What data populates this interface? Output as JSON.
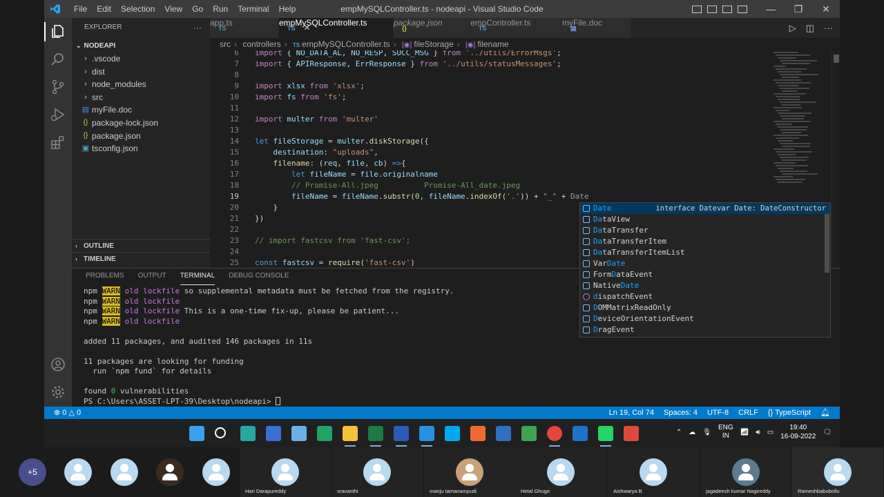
{
  "window": {
    "title": "empMySQLController.ts - nodeapi - Visual Studio Code",
    "menu": [
      "File",
      "Edit",
      "Selection",
      "View",
      "Go",
      "Run",
      "Terminal",
      "Help"
    ]
  },
  "activity_bar": {
    "items": [
      "explorer-icon",
      "search-icon",
      "source-control-icon",
      "run-debug-icon",
      "extensions-icon"
    ],
    "bottom": [
      "account-icon",
      "settings-gear-icon"
    ]
  },
  "explorer": {
    "title": "EXPLORER",
    "more": "···",
    "root": "NODEAPI",
    "items": [
      {
        "label": ".vscode",
        "type": "folder"
      },
      {
        "label": "dist",
        "type": "folder"
      },
      {
        "label": "node_modules",
        "type": "folder"
      },
      {
        "label": "src",
        "type": "folder"
      },
      {
        "label": "myFile.doc",
        "type": "doc"
      },
      {
        "label": "package-lock.json",
        "type": "json"
      },
      {
        "label": "package.json",
        "type": "json"
      },
      {
        "label": "tsconfig.json",
        "type": "ts"
      }
    ],
    "outline": "OUTLINE",
    "timeline": "TIMELINE"
  },
  "tabs": [
    {
      "label": "app.ts",
      "icon": "TS",
      "active": false
    },
    {
      "label": "empMySQLController.ts",
      "icon": "TS",
      "active": true,
      "close": "✕"
    },
    {
      "label": "package.json",
      "icon": "{}",
      "active": false
    },
    {
      "label": "empController.ts",
      "icon": "TS",
      "active": false
    },
    {
      "label": "myFile.doc",
      "icon": "doc",
      "active": false
    }
  ],
  "breadcrumb": [
    "src",
    "controllers",
    "empMySQLController.ts",
    "fileStorage",
    "filename"
  ],
  "editor": {
    "line_numbers": [
      "6",
      "7",
      "8",
      "9",
      "10",
      "11",
      "12",
      "13",
      "14",
      "15",
      "16",
      "17",
      "18",
      "19",
      "20",
      "21",
      "22",
      "23",
      "24",
      "25"
    ],
    "current_line": "19",
    "ghost_text": "Date"
  },
  "suggest": {
    "items": [
      {
        "pre": "",
        "hl": "Date",
        "post": "",
        "detail": "interface Datevar Date: DateConstructor",
        "kind": "interface"
      },
      {
        "pre": "",
        "hl": "Da",
        "post": "taView",
        "kind": "interface"
      },
      {
        "pre": "",
        "hl": "Da",
        "post": "taTransfer",
        "kind": "interface"
      },
      {
        "pre": "",
        "hl": "Da",
        "post": "taTransferItem",
        "kind": "interface"
      },
      {
        "pre": "",
        "hl": "Da",
        "post": "taTransferItemList",
        "kind": "interface"
      },
      {
        "pre": "Var",
        "hl": "Date",
        "post": "",
        "kind": "variable"
      },
      {
        "pre": "Form",
        "hl": "D",
        "post": "ataEvent",
        "kind": "interface"
      },
      {
        "pre": "Native",
        "hl": "Date",
        "post": "",
        "kind": "interface"
      },
      {
        "pre": "",
        "hl": "d",
        "post": "ispatchEvent",
        "kind": "method"
      },
      {
        "pre": "",
        "hl": "D",
        "post": "OMMatrixReadOnly",
        "kind": "interface"
      },
      {
        "pre": "",
        "hl": "D",
        "post": "eviceOrientationEvent",
        "kind": "interface"
      },
      {
        "pre": "",
        "hl": "D",
        "post": "ragEvent",
        "kind": "interface"
      }
    ]
  },
  "panel": {
    "tabs": [
      "PROBLEMS",
      "OUTPUT",
      "TERMINAL",
      "DEBUG CONSOLE"
    ],
    "active": "TERMINAL",
    "terminal": {
      "npm": "npm",
      "warn": "WARN",
      "old_lockfile": "old lockfile",
      "l1_rest": " so supplemental metadata must be fetched from the registry.",
      "l3_rest": " This is a one-time fix-up, please be patient...",
      "added": "added 11 packages, and audited 146 packages in 11s",
      "funding1": "11 packages are looking for funding",
      "funding2": "  run `npm fund` for details",
      "found_pre": "found ",
      "found_num": "0",
      "found_post": " vulnerabilities",
      "prompt": "PS C:\\Users\\ASSET-LPT-39\\Desktop\\nodeapi> "
    }
  },
  "status": {
    "errors": "⊗ 0 △ 0",
    "position": "Ln 19, Col 74",
    "spaces": "Spaces: 4",
    "encoding": "UTF-8",
    "eol": "CRLF",
    "language": "{} TypeScript",
    "bell": "🔔"
  },
  "taskbar": {
    "apps": [
      "windows-start-icon",
      "search-icon",
      "browser-icon",
      "remote-desktop-icon",
      "notepad-icon",
      "sheets-icon",
      "file-explorer-icon",
      "excel-icon",
      "word-icon",
      "vscode-icon",
      "skype-icon",
      "postman-icon",
      "app-icon",
      "mongodb-compass-icon",
      "chrome-icon",
      "outlook-icon",
      "whatsapp-icon",
      "anydesk-icon"
    ],
    "lang_line1": "ENG",
    "lang_line2": "IN",
    "time": "19:40",
    "date": "16-09-2022"
  },
  "meeting": {
    "overflow": "+5",
    "participants": [
      {
        "name": ""
      },
      {
        "name": ""
      },
      {
        "name": ""
      },
      {
        "name": ""
      },
      {
        "name": "Hari Darapureddy"
      },
      {
        "name": "sravanthi"
      },
      {
        "name": "manju tamanampudi"
      },
      {
        "name": "Hetal Ghuge"
      },
      {
        "name": "Aishwarya B"
      },
      {
        "name": "jagadeesh kumar Nagireddy"
      },
      {
        "name": "Rameshbabubollu"
      }
    ]
  },
  "colors": {
    "accent": "#007acc",
    "editor_bg": "#1e1e1e",
    "sidebar_bg": "#252526",
    "warn_bg": "#d7ba29"
  }
}
